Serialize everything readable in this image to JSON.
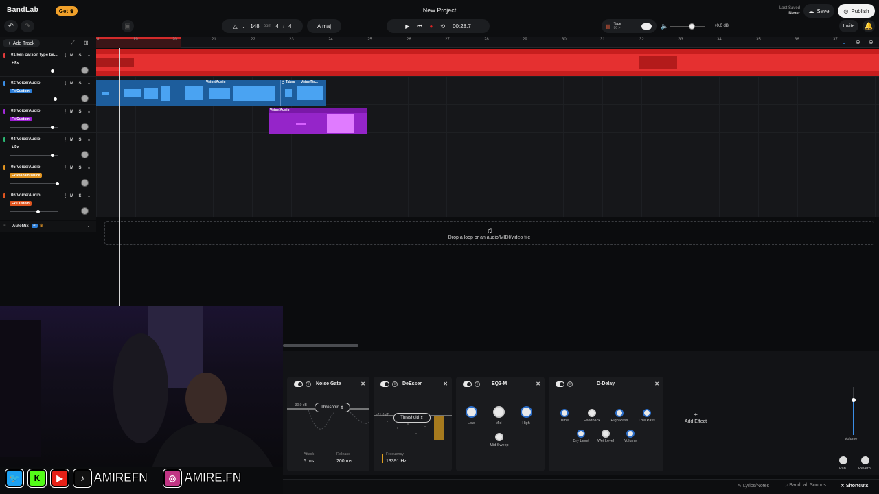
{
  "app": {
    "logo": "BandLab",
    "get_label": "Get",
    "title": "New Project",
    "last_saved_label": "Last Saved",
    "last_saved_value": "Never"
  },
  "toolbar": {
    "bpm": "148",
    "bpm_unit": "bpm",
    "time_sig_num": "4",
    "time_sig_den": "4",
    "key": "A maj",
    "time": "00:28.7",
    "tape_label": "Tape",
    "tape_sub": "80 >",
    "master_db": "+0.0 dB",
    "save_label": "Save",
    "publish_label": "Publish",
    "invite_label": "Invite"
  },
  "ruler": {
    "ticks": [
      "8",
      "19",
      "20",
      "21",
      "22",
      "23",
      "24",
      "25",
      "26",
      "27",
      "28",
      "29",
      "30",
      "31",
      "32",
      "33",
      "34",
      "35",
      "36",
      "37"
    ]
  },
  "add_track_label": "Add Track",
  "tracks": [
    {
      "name": "01 ken carson type be...",
      "fx": "+ Fx",
      "fx_color": "",
      "color": "#e23b3b",
      "mute": "M",
      "solo": "S",
      "volume": 0.9
    },
    {
      "name": "02 Voice/Audio",
      "fx": "Fx Custom",
      "fx_color": "#2d7fd9",
      "color": "#3b8ee6",
      "mute": "M",
      "solo": "S",
      "volume": 0.95
    },
    {
      "name": "03 Voice/Audio",
      "fx": "Fx Custom",
      "fx_color": "#9b1fd1",
      "color": "#a22ad8",
      "mute": "M",
      "solo": "S",
      "volume": 0.9
    },
    {
      "name": "04 Voice/Audio",
      "fx": "+ Fx",
      "fx_color": "",
      "color": "#2bb673",
      "mute": "M",
      "solo": "S",
      "volume": 0.9
    },
    {
      "name": "05 Voice/Audio",
      "fx": "Fx kaanamisauce",
      "fx_color": "#e0931f",
      "color": "#e0931f",
      "mute": "M",
      "solo": "S",
      "volume": 1.0
    },
    {
      "name": "06 Voice/Audio",
      "fx": "Fx Custom",
      "fx_color": "#e0551f",
      "color": "#e0551f",
      "mute": "M",
      "solo": "S",
      "volume": 0.6
    }
  ],
  "automix": {
    "label": "AutoMix",
    "badge": "AI"
  },
  "clips": {
    "voice_audio": "Voice/Audio",
    "takes": "Takes",
    "voice_re": "Voice/Re..."
  },
  "drop_zone": "Drop a loop or an audio/MIDI/video file",
  "effects": {
    "noise_gate": {
      "title": "Noise Gate",
      "threshold_label": "Threshold",
      "threshold_value": "-30.0 dB",
      "attack_label": "Attack",
      "attack_value": "5 ms",
      "release_label": "Release",
      "release_value": "200 ms"
    },
    "deesser": {
      "title": "DeEsser",
      "threshold_label": "Threshold",
      "threshold_value": "-21.0 dB",
      "frequency_label": "Frequency",
      "frequency_value": "13391 Hz"
    },
    "eq3": {
      "title": "EQ3-M",
      "low": "Low",
      "mid": "Mid",
      "high": "High",
      "mid_sweep": "Mid Sweep"
    },
    "delay": {
      "title": "D-Delay",
      "time": "Time",
      "feedback": "Feedback",
      "high_pass": "High Pass",
      "low_pass": "Low Pass",
      "dry_level": "Dry Level",
      "wet_level": "Wet Level",
      "volume": "Volume"
    },
    "add_effect_label": "Add Effect"
  },
  "master": {
    "volume_label": "Volume",
    "pan_label": "Pan",
    "reverb_label": "Reverb"
  },
  "footer": {
    "lyrics": "Lyrics/Notes",
    "sounds": "BandLab Sounds",
    "shortcuts": "Shortcuts"
  },
  "social": {
    "handle1": "AMIREFN",
    "handle2": "AMIRE.FN"
  },
  "colors": {
    "accent_red": "#e02424",
    "accent_blue": "#3b8ee6",
    "accent_purple": "#a22ad8"
  }
}
